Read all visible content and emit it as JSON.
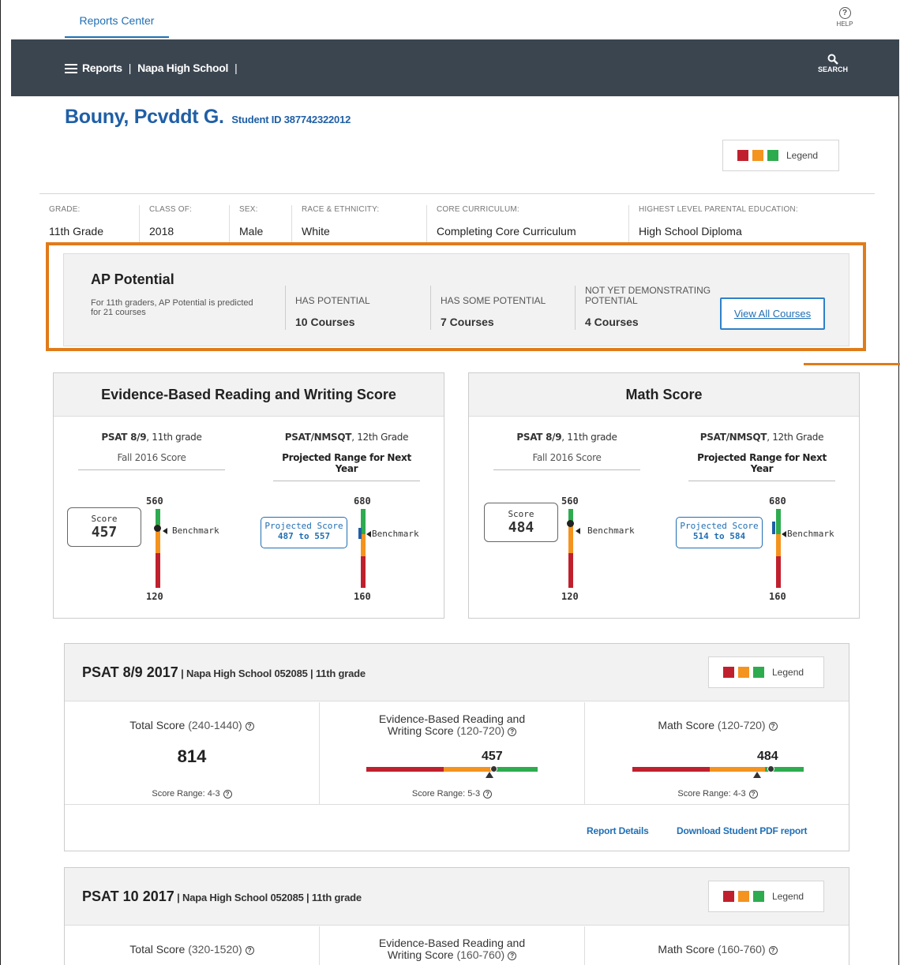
{
  "topbar": {
    "tab": "Reports Center",
    "help": "HELP"
  },
  "nav": {
    "reports": "Reports",
    "school": "Napa High School",
    "search": "SEARCH"
  },
  "student": {
    "name": "Bouny, Pcvddt G.",
    "id_label": "Student ID 387742322012"
  },
  "legend_label": "Legend",
  "demographics": [
    {
      "key": "GRADE:",
      "value": "11th Grade"
    },
    {
      "key": "CLASS OF:",
      "value": "2018"
    },
    {
      "key": "SEX:",
      "value": "Male"
    },
    {
      "key": "RACE & ETHNICITY:",
      "value": "White"
    },
    {
      "key": "CORE CURRICULUM:",
      "value": "Completing Core Curriculum"
    },
    {
      "key": "HIGHEST LEVEL PARENTAL EDUCATION:",
      "value": "High School Diploma"
    }
  ],
  "ap": {
    "title": "AP Potential",
    "desc": "For 11th graders, AP Potential is predicted for 21 courses",
    "cols": [
      {
        "key": "HAS POTENTIAL",
        "value": "10 Courses"
      },
      {
        "key": "HAS SOME POTENTIAL",
        "value": "7 Courses"
      },
      {
        "key": "NOT YET DEMONSTRATING POTENTIAL",
        "value": "4 Courses"
      }
    ],
    "button": "View All Courses"
  },
  "score_cards": [
    {
      "title": "Evidence-Based Reading and Writing Score",
      "left": {
        "test": "PSAT 8/9",
        "grade": ", 11th grade",
        "sub": "Fall 2016 Score",
        "score_label": "Score",
        "score": "457",
        "top": "560",
        "bottom": "120",
        "benchmark": "Benchmark"
      },
      "right": {
        "test": "PSAT/NMSQT",
        "grade": ", 12th Grade",
        "sub": "Projected Range for Next Year",
        "proj_label": "Projected Score",
        "proj_range": "487 to 557",
        "top": "680",
        "bottom": "160",
        "benchmark": "Benchmark"
      }
    },
    {
      "title": "Math Score",
      "left": {
        "test": "PSAT 8/9",
        "grade": ", 11th grade",
        "sub": "Fall 2016 Score",
        "score_label": "Score",
        "score": "484",
        "top": "560",
        "bottom": "120",
        "benchmark": "Benchmark"
      },
      "right": {
        "test": "PSAT/NMSQT",
        "grade": ", 12th Grade",
        "sub": "Projected Range for Next Year",
        "proj_label": "Projected Score",
        "proj_range": "514 to 584",
        "top": "680",
        "bottom": "160",
        "benchmark": "Benchmark"
      }
    }
  ],
  "panels": [
    {
      "title": "PSAT 8/9 2017",
      "subtitle": " | Napa High School 052085 | 11th grade",
      "total_label": "Total Score",
      "total_range": " (240-1440)",
      "total": "814",
      "total_sr": "Score Range: 4-3",
      "ebrw_label_1": "Evidence-Based Reading and",
      "ebrw_label_2": "Writing Score",
      "ebrw_range": " (120-720)",
      "ebrw": "457",
      "ebrw_sr": "Score Range: 5-3",
      "math_label": "Math Score",
      "math_range": " (120-720)",
      "math": "484",
      "math_sr": "Score Range: 4-3",
      "link1": "Report Details",
      "link2": "Download Student PDF report"
    },
    {
      "title": "PSAT 10 2017",
      "subtitle": " | Napa High School 052085 | 11th grade",
      "total_label": "Total Score",
      "total_range": " (320-1520)",
      "ebrw_label_1": "Evidence-Based Reading and",
      "ebrw_label_2": "Writing Score",
      "ebrw_range": " (160-760)",
      "math_label": "Math Score",
      "math_range": " (160-760)"
    }
  ],
  "colors": {
    "red": "#c0202d",
    "orange": "#f4931e",
    "green": "#2eab4f",
    "accent": "#1f6fb5",
    "highlight": "#e07b1a"
  }
}
